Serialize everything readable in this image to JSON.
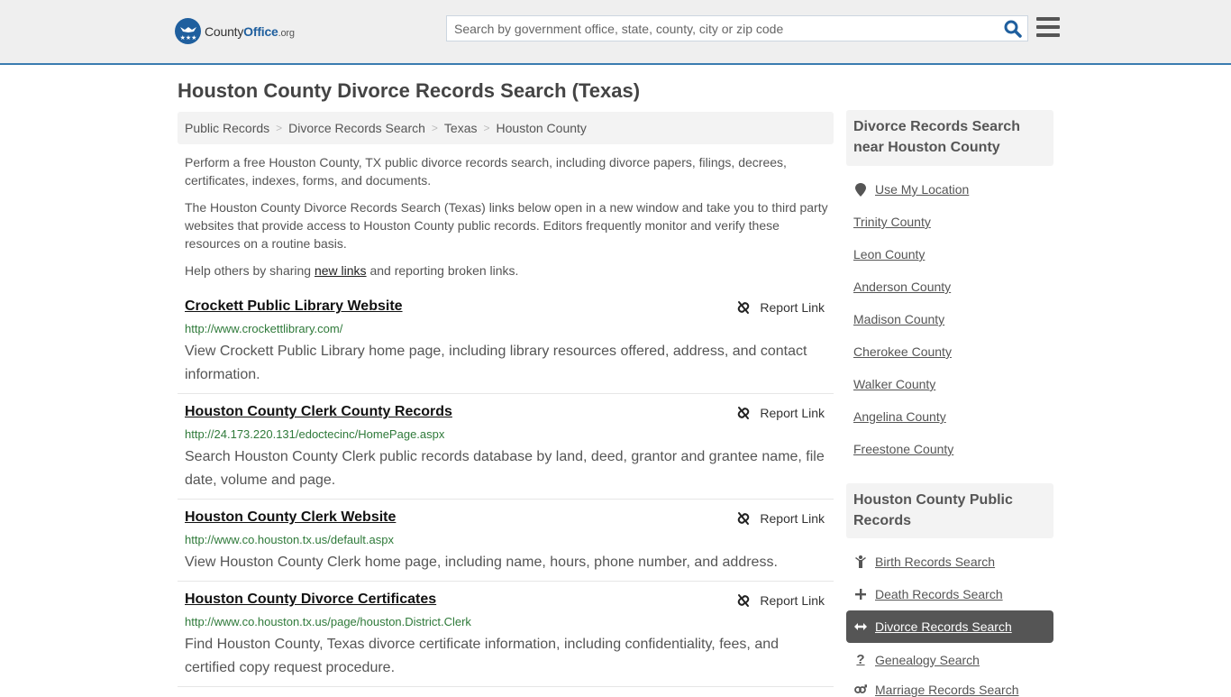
{
  "header": {
    "logo": {
      "name_part1": "County",
      "name_part2": "Office",
      "name_part3": ".org"
    },
    "search_placeholder": "Search by government office, state, county, city or zip code",
    "search_icon": "search-icon",
    "menu_icon": "hamburger-menu-icon"
  },
  "page_title": "Houston County Divorce Records Search (Texas)",
  "breadcrumb": [
    {
      "label": "Public Records"
    },
    {
      "label": "Divorce Records Search"
    },
    {
      "label": "Texas"
    },
    {
      "label": "Houston County"
    }
  ],
  "breadcrumb_separator": ">",
  "intro": {
    "p1": "Perform a free Houston County, TX public divorce records search, including divorce papers, filings, decrees, certificates, indexes, forms, and documents.",
    "p2": "The Houston County Divorce Records Search (Texas) links below open in a new window and take you to third party websites that provide access to Houston County public records. Editors frequently monitor and verify these resources on a routine basis.",
    "p3_before": "Help others by sharing ",
    "p3_link": "new links",
    "p3_after": " and reporting broken links."
  },
  "report_link_label": "Report Link",
  "results": [
    {
      "title": "Crockett Public Library Website",
      "url": "http://www.crockettlibrary.com/",
      "description": "View Crockett Public Library home page, including library resources offered, address, and contact information."
    },
    {
      "title": "Houston County Clerk County Records",
      "url": "http://24.173.220.131/edoctecinc/HomePage.aspx",
      "description": "Search Houston County Clerk public records database by land, deed, grantor and grantee name, file date, volume and page."
    },
    {
      "title": "Houston County Clerk Website",
      "url": "http://www.co.houston.tx.us/default.aspx",
      "description": "View Houston County Clerk home page, including name, hours, phone number, and address."
    },
    {
      "title": "Houston County Divorce Certificates",
      "url": "http://www.co.houston.tx.us/page/houston.District.Clerk",
      "description": "Find Houston County, Texas divorce certificate information, including confidentiality, fees, and certified copy request procedure."
    }
  ],
  "sidebar": {
    "nearby_heading": "Divorce Records Search near Houston County",
    "use_location": "Use My Location",
    "nearby": [
      "Trinity County",
      "Leon County",
      "Anderson County",
      "Madison County",
      "Cherokee County",
      "Walker County",
      "Angelina County",
      "Freestone County"
    ],
    "records_heading": "Houston County Public Records",
    "records": [
      {
        "label": "Birth Records Search",
        "icon": "child-icon",
        "active": false
      },
      {
        "label": "Death Records Search",
        "icon": "cross-icon",
        "active": false
      },
      {
        "label": "Divorce Records Search",
        "icon": "arrows-horizontal-icon",
        "active": true
      },
      {
        "label": "Genealogy Search",
        "icon": "question-icon",
        "active": false
      },
      {
        "label": "Marriage Records Search",
        "icon": "gender-icon",
        "active": false
      }
    ]
  },
  "colors": {
    "brand_blue": "#1f5f9e",
    "header_border": "#3a7cb0",
    "url_green": "#2f7a3a",
    "active_item_bg": "#555555"
  }
}
